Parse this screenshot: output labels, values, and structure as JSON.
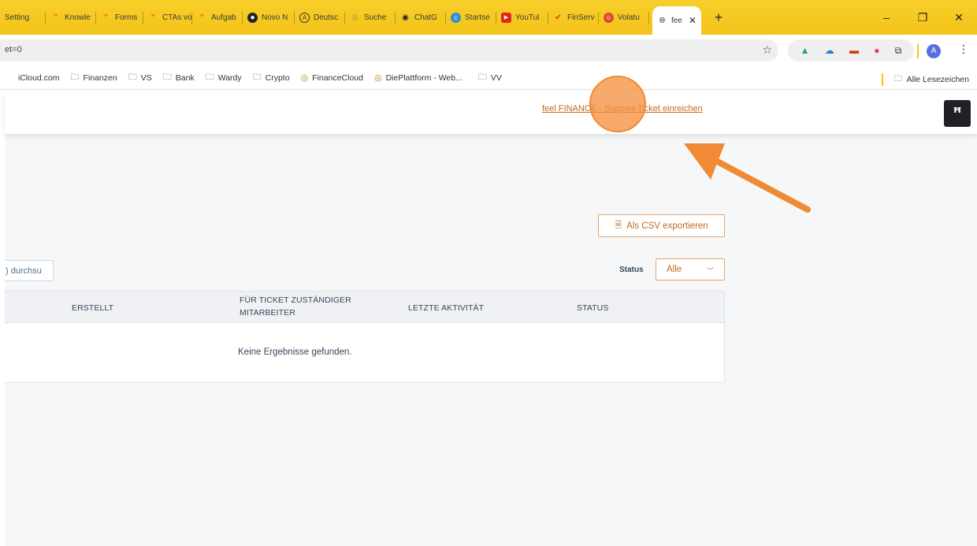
{
  "tabs": [
    {
      "label": "Setting",
      "icon": "generic-icon"
    },
    {
      "label": "Knowle",
      "icon": "hubspot-icon"
    },
    {
      "label": "Forms",
      "icon": "hubspot-icon"
    },
    {
      "label": "CTAs vo",
      "icon": "hubspot-icon"
    },
    {
      "label": "Aufgab",
      "icon": "hubspot-icon"
    },
    {
      "label": "Novo N",
      "icon": "novo-icon"
    },
    {
      "label": "Deutsc",
      "icon": "a-icon"
    },
    {
      "label": "Suche",
      "icon": "feel-icon"
    },
    {
      "label": "ChatG",
      "icon": "chatgpt-icon"
    },
    {
      "label": "Startse",
      "icon": "c-icon"
    },
    {
      "label": "YouTul",
      "icon": "youtube-icon"
    },
    {
      "label": "FinServ",
      "icon": "check-icon"
    },
    {
      "label": "Volatu",
      "icon": "face-icon"
    }
  ],
  "active_tab": {
    "label": "fee",
    "icon": "globe-icon"
  },
  "address": {
    "url": "et=0"
  },
  "bookmarks": [
    {
      "label": "iCloud.com",
      "icon": "apple-icon"
    },
    {
      "label": "Finanzen",
      "icon": "folder-icon"
    },
    {
      "label": "VS",
      "icon": "folder-icon"
    },
    {
      "label": "Bank",
      "icon": "folder-icon"
    },
    {
      "label": "Wardy",
      "icon": "folder-icon"
    },
    {
      "label": "Crypto",
      "icon": "folder-icon"
    },
    {
      "label": "FinanceCloud",
      "icon": "feel-icon"
    },
    {
      "label": "DiePlattform - Web...",
      "icon": "feel-icon"
    },
    {
      "label": "VV",
      "icon": "folder-icon"
    }
  ],
  "bookmarks_all": "Alle Lesezeichen",
  "header": {
    "support_link": "feel FINANCE - Support-Ticket einreichen"
  },
  "toolbar": {
    "csv_label": "Als CSV exportieren",
    "search_text": ") durchsu"
  },
  "filter": {
    "status_label": "Status",
    "status_value": "Alle"
  },
  "table": {
    "columns": [
      "ERSTELLT",
      "FÜR TICKET ZUSTÄNDIGER MITARBEITER",
      "LETZTE AKTIVITÄT",
      "STATUS"
    ],
    "empty_message": "Keine Ergebnisse gefunden."
  },
  "colors": {
    "accent": "#c26a1c",
    "tabbar": "#f5c518",
    "highlight": "#f48d3a"
  }
}
